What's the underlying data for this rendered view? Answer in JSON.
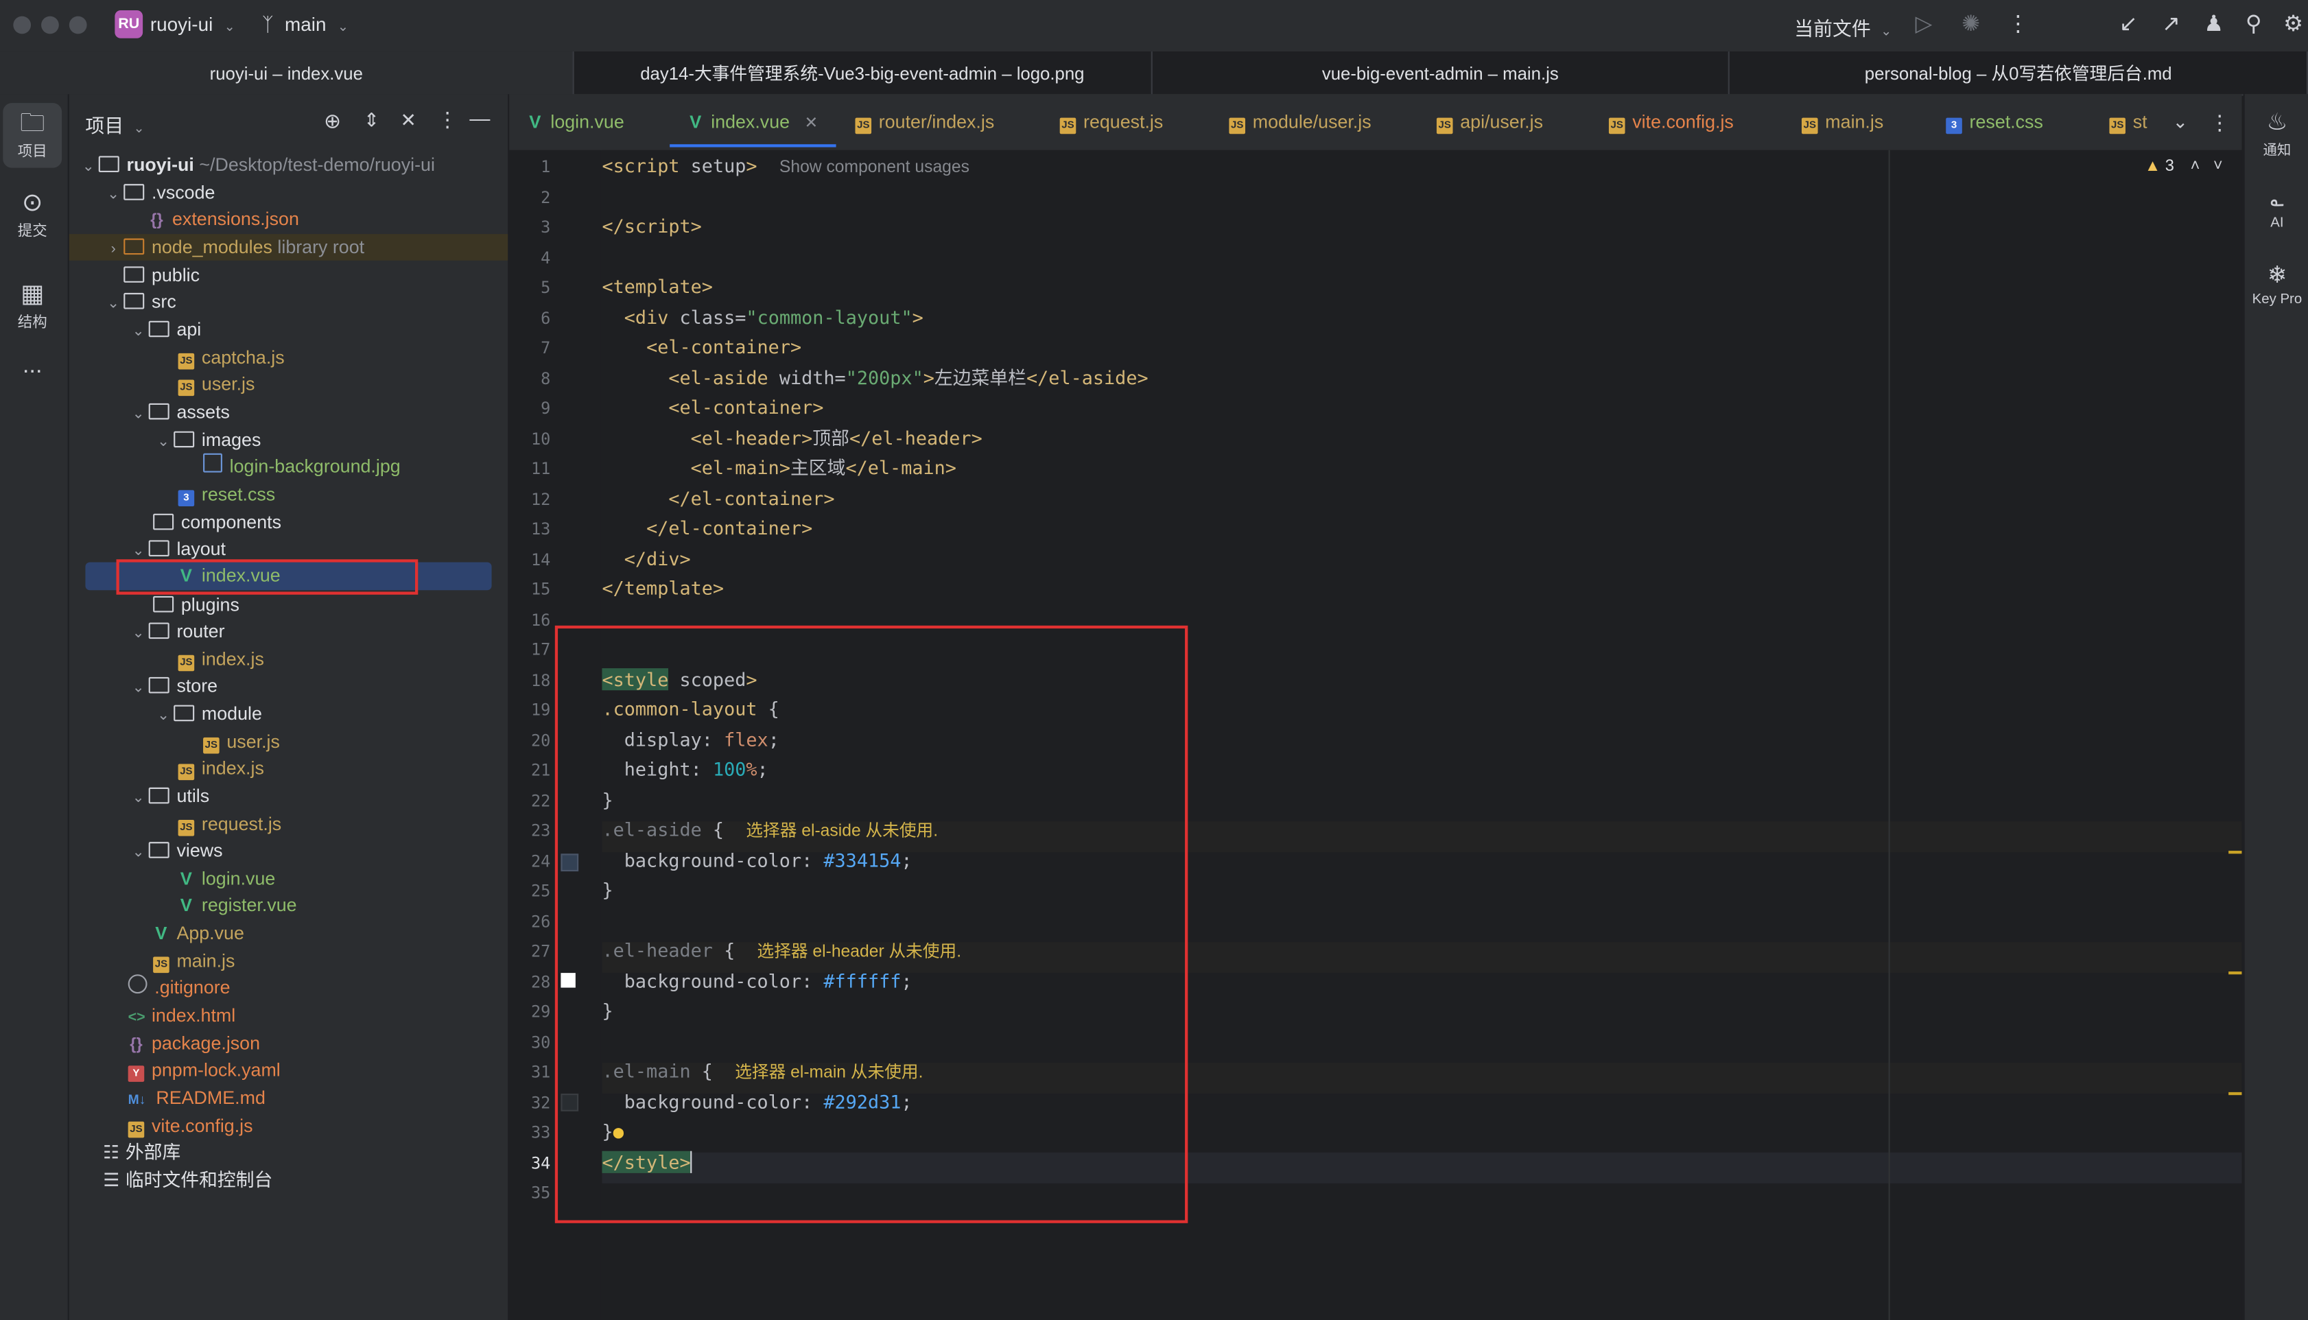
{
  "titlebar": {
    "project_badge": "RU",
    "project_name": "ruoyi-ui",
    "branch": "main",
    "run_config": "当前文件"
  },
  "window_tabs": [
    "ruoyi-ui – index.vue",
    "day14-大事件管理系统-Vue3-big-event-admin – logo.png",
    "vue-big-event-admin – main.js",
    "personal-blog – 从0写若依管理后台.md"
  ],
  "left_strip": {
    "project": "项目",
    "commit": "提交",
    "structure": "结构",
    "more": "..."
  },
  "right_strip": {
    "notifications": "通知",
    "ai": "AI",
    "key_promoter": "Key Pro"
  },
  "project_panel": {
    "title": "项目",
    "tree": [
      {
        "label": "ruoyi-ui",
        "suffix": "~/Desktop/test-demo/ruoyi-ui"
      },
      {
        "label": ".vscode"
      },
      {
        "label": "extensions.json"
      },
      {
        "label": "node_modules",
        "suffix": "library root"
      },
      {
        "label": "public"
      },
      {
        "label": "src"
      },
      {
        "label": "api"
      },
      {
        "label": "captcha.js"
      },
      {
        "label": "user.js"
      },
      {
        "label": "assets"
      },
      {
        "label": "images"
      },
      {
        "label": "login-background.jpg"
      },
      {
        "label": "reset.css"
      },
      {
        "label": "components"
      },
      {
        "label": "layout"
      },
      {
        "label": "index.vue"
      },
      {
        "label": "plugins"
      },
      {
        "label": "router"
      },
      {
        "label": "index.js"
      },
      {
        "label": "store"
      },
      {
        "label": "module"
      },
      {
        "label": "user.js"
      },
      {
        "label": "index.js"
      },
      {
        "label": "utils"
      },
      {
        "label": "request.js"
      },
      {
        "label": "views"
      },
      {
        "label": "login.vue"
      },
      {
        "label": "register.vue"
      },
      {
        "label": "App.vue"
      },
      {
        "label": "main.js"
      },
      {
        "label": ".gitignore"
      },
      {
        "label": "index.html"
      },
      {
        "label": "package.json"
      },
      {
        "label": "pnpm-lock.yaml"
      },
      {
        "label": "README.md"
      },
      {
        "label": "vite.config.js"
      },
      {
        "label": "外部库"
      },
      {
        "label": "临时文件和控制台"
      }
    ]
  },
  "editor_tabs": [
    {
      "label": "login.vue"
    },
    {
      "label": "index.vue"
    },
    {
      "label": "router/index.js"
    },
    {
      "label": "request.js"
    },
    {
      "label": "module/user.js"
    },
    {
      "label": "api/user.js"
    },
    {
      "label": "vite.config.js"
    },
    {
      "label": "main.js"
    },
    {
      "label": "reset.css"
    },
    {
      "label": "st"
    }
  ],
  "editor": {
    "warning_count": "3",
    "show_usages_hint": "Show component usages",
    "unused_aside": "选择器 el-aside 从未使用.",
    "unused_header": "选择器 el-header 从未使用.",
    "unused_main": "选择器 el-main 从未使用.",
    "aside_width": "\"200px\"",
    "aside_text": "左边菜单栏",
    "header_text": "顶部",
    "main_text": "主区域",
    "class_value": "\"common-layout\"",
    "color_aside": "#334154",
    "color_header": "#ffffff",
    "color_main": "#292d31",
    "line_numbers": [
      "1",
      "2",
      "3",
      "4",
      "5",
      "6",
      "7",
      "8",
      "9",
      "10",
      "11",
      "12",
      "13",
      "14",
      "15",
      "16",
      "17",
      "18",
      "19",
      "20",
      "21",
      "22",
      "23",
      "24",
      "25",
      "26",
      "27",
      "28",
      "29",
      "30",
      "31",
      "32",
      "33",
      "34",
      "35"
    ]
  },
  "colors": {
    "accent": "#3574f0",
    "highlight_box": "#e03131",
    "swatch_aside": "#334154",
    "swatch_header": "#ffffff",
    "swatch_main": "#292d31"
  }
}
